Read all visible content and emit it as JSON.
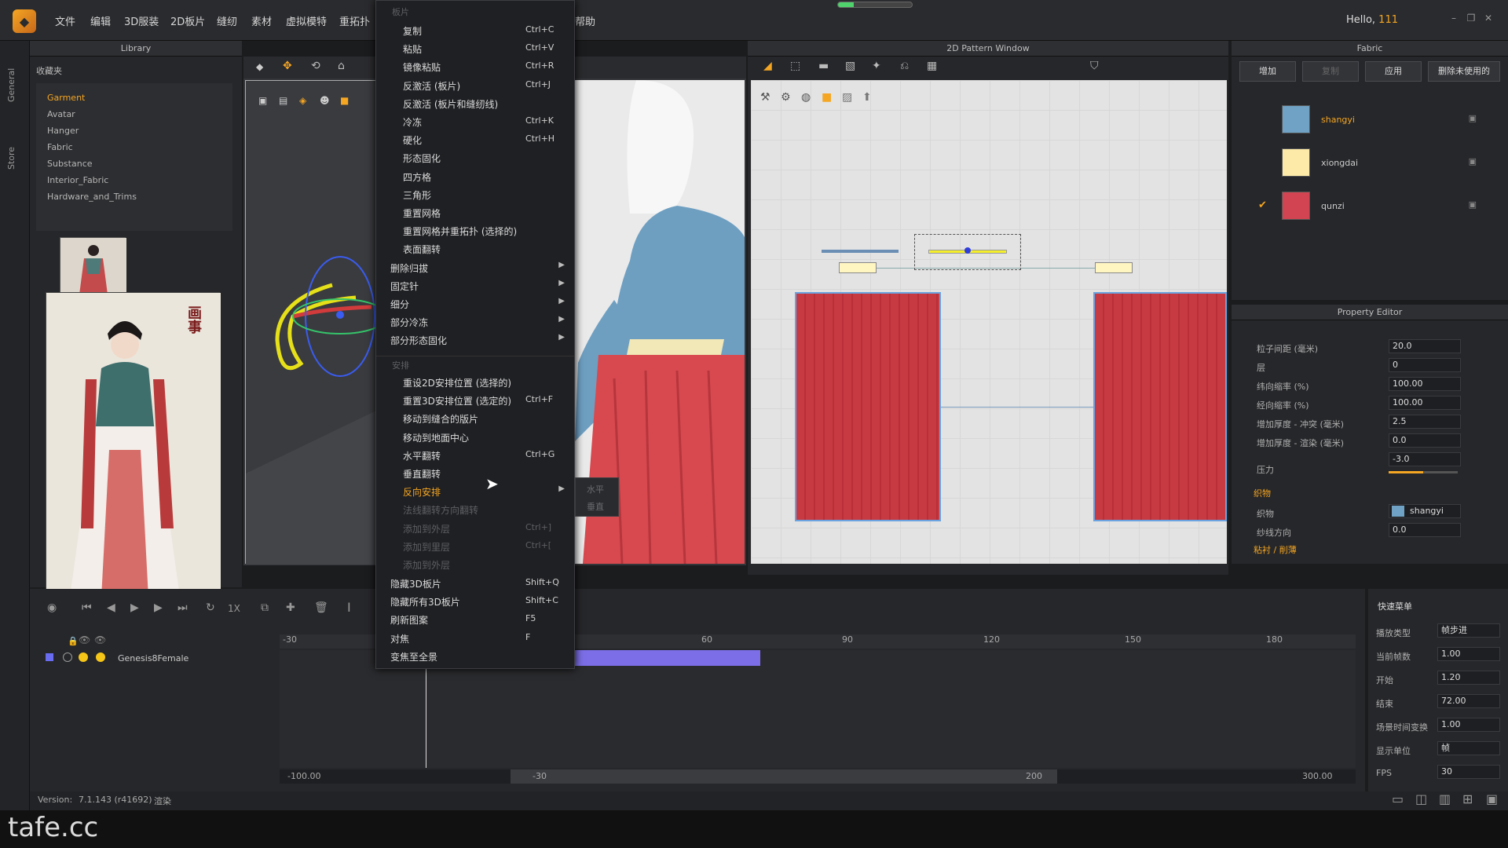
{
  "menubar": {
    "items": [
      "文件",
      "编辑",
      "3D服装",
      "2D板片",
      "缝纫",
      "素材",
      "虚拟模特",
      "重拓扑"
    ],
    "help": "帮助",
    "hello_prefix": "Hello, ",
    "user": "111"
  },
  "rail": {
    "tab1": "General",
    "tab2": "Store"
  },
  "library": {
    "title": "Library",
    "favorites": "收藏夹",
    "items": [
      "Garment",
      "Avatar",
      "Hanger",
      "Fabric",
      "Substance",
      "Interior_Fabric",
      "Hardware_and_Trims"
    ],
    "active_item": "Garment"
  },
  "pattern_window": {
    "title": "2D Pattern Window"
  },
  "fabric": {
    "title": "Fabric",
    "buttons": [
      "增加",
      "复制",
      "应用",
      "删除未使用的"
    ],
    "items": [
      {
        "name": "shangyi",
        "color": "#6fa2c4",
        "checked": false,
        "active": true
      },
      {
        "name": "xiongdai",
        "color": "#fdeaa8",
        "checked": false,
        "active": false
      },
      {
        "name": "qunzi",
        "color": "#d24452",
        "checked": true,
        "active": false
      }
    ]
  },
  "property_editor": {
    "title": "Property Editor",
    "rows": [
      {
        "label": "粒子间距 (毫米)",
        "value": "20.0"
      },
      {
        "label": "层",
        "value": "0"
      },
      {
        "label": "纬向缩率 (%)",
        "value": "100.00"
      },
      {
        "label": "经向缩率 (%)",
        "value": "100.00"
      },
      {
        "label": "增加厚度 - 冲突 (毫米)",
        "value": "2.5"
      },
      {
        "label": "增加厚度 - 渲染 (毫米)",
        "value": "0.0"
      },
      {
        "label": "",
        "value": "-3.0"
      }
    ],
    "pressure_label": "压力",
    "fabric_section": "织物",
    "fabric_label": "织物",
    "fabric_value": "shangyi",
    "grain_label": "纱线方向",
    "grain_value": "0.0",
    "interlining_section": "粘衬 / 削薄"
  },
  "context_menu": {
    "header_edit": "板片",
    "items": [
      {
        "label": "复制",
        "shortcut": "Ctrl+C",
        "indent": true
      },
      {
        "label": "粘贴",
        "shortcut": "Ctrl+V",
        "indent": true
      },
      {
        "label": "镜像粘贴",
        "shortcut": "Ctrl+R",
        "indent": true
      },
      {
        "label": "反激活 (板片)",
        "shortcut": "Ctrl+J",
        "indent": true
      },
      {
        "label": "反激活 (板片和缝纫线)",
        "shortcut": "",
        "indent": true
      },
      {
        "label": "冷冻",
        "shortcut": "Ctrl+K",
        "indent": true
      },
      {
        "label": "硬化",
        "shortcut": "Ctrl+H",
        "indent": true
      },
      {
        "label": "形态固化",
        "shortcut": "",
        "indent": true
      },
      {
        "label": "四方格",
        "shortcut": "",
        "indent": true
      },
      {
        "label": "三角形",
        "shortcut": "",
        "indent": true
      },
      {
        "label": "重置网格",
        "shortcut": "",
        "indent": true
      },
      {
        "label": "重置网格并重拓扑 (选择的)",
        "shortcut": "",
        "indent": true
      },
      {
        "label": "表面翻转",
        "shortcut": "",
        "indent": true
      },
      {
        "label": "删除归拔",
        "shortcut": "",
        "indent": false,
        "submenu": true
      },
      {
        "label": "固定针",
        "shortcut": "",
        "indent": false,
        "submenu": true
      },
      {
        "label": "细分",
        "shortcut": "",
        "indent": false,
        "submenu": true
      },
      {
        "label": "部分冷冻",
        "shortcut": "",
        "indent": false,
        "submenu": true
      },
      {
        "label": "部分形态固化",
        "shortcut": "",
        "indent": false,
        "submenu": true
      }
    ],
    "header_arrange": "安排",
    "arrange_items": [
      {
        "label": "重设2D安排位置 (选择的)",
        "shortcut": "",
        "indent": true
      },
      {
        "label": "重置3D安排位置 (选定的)",
        "shortcut": "Ctrl+F",
        "indent": true
      },
      {
        "label": "移动到缝合的版片",
        "shortcut": "",
        "indent": true
      },
      {
        "label": "移动到地面中心",
        "shortcut": "",
        "indent": true
      },
      {
        "label": "水平翻转",
        "shortcut": "Ctrl+G",
        "indent": true
      },
      {
        "label": "垂直翻转",
        "shortcut": "",
        "indent": true
      },
      {
        "label": "反向安排",
        "shortcut": "",
        "indent": true,
        "submenu": true,
        "highlight": true
      },
      {
        "label": "法线翻转方向翻转",
        "shortcut": "",
        "indent": true,
        "disabled": true
      },
      {
        "label": "添加到外层",
        "shortcut": "Ctrl+]",
        "indent": true,
        "disabled": true
      },
      {
        "label": "添加到里层",
        "shortcut": "Ctrl+[",
        "indent": true,
        "disabled": true
      },
      {
        "label": "添加到外层",
        "shortcut": "",
        "indent": true,
        "disabled": true
      }
    ],
    "bottom_items": [
      {
        "label": "隐藏3D板片",
        "shortcut": "Shift+Q"
      },
      {
        "label": "隐藏所有3D板片",
        "shortcut": "Shift+C"
      },
      {
        "label": "刷新图案",
        "shortcut": "F5"
      },
      {
        "label": "对焦",
        "shortcut": "F"
      },
      {
        "label": "变焦至全景",
        "shortcut": ""
      }
    ],
    "submenu_items": [
      "水平",
      "垂直"
    ]
  },
  "timeline": {
    "track_name": "Genesis8Female",
    "ruler": [
      "-30",
      "60",
      "90",
      "120",
      "150",
      "180"
    ],
    "scroll_left": "-100.00",
    "scroll_mid_left": "-30",
    "scroll_mid_right": "200",
    "scroll_right": "300.00",
    "speed": "1X"
  },
  "quick_menu": {
    "title": "快速菜单",
    "rows": [
      {
        "label": "播放类型",
        "value": "帧步进"
      },
      {
        "label": "当前帧数",
        "value": "1.00"
      },
      {
        "label": "开始",
        "value": "1.20"
      },
      {
        "label": "结束",
        "value": "72.00"
      },
      {
        "label": "场景时间变换",
        "value": "1.00"
      },
      {
        "label": "显示单位",
        "value": "帧"
      },
      {
        "label": "FPS",
        "value": "30"
      }
    ]
  },
  "status": {
    "version_label": "Version:",
    "version": "7.1.143 (r41692)",
    "extra": "渲染"
  },
  "watermark": "tafe.cc",
  "preview_stamp": "画事"
}
